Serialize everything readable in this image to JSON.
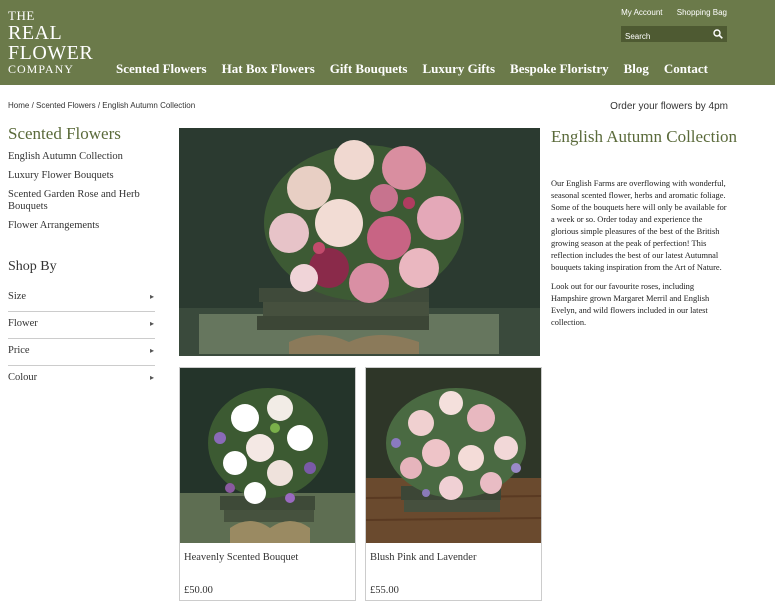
{
  "logo": {
    "line1": "THE",
    "line2": "REAL",
    "line3": "FLOWER",
    "line4": "COMPANY"
  },
  "toplinks": {
    "account": "My Account",
    "bag": "Shopping Bag"
  },
  "search": {
    "placeholder": "Search"
  },
  "nav": [
    "Scented Flowers",
    "Hat Box Flowers",
    "Gift Bouquets",
    "Luxury Gifts",
    "Bespoke Floristry",
    "Blog",
    "Contact"
  ],
  "breadcrumb": "Home / Scented Flowers / English Autumn Collection",
  "order_note": "Order your flowers by 4pm",
  "sidebar": {
    "title": "Scented Flowers",
    "links": [
      "English Autumn Collection",
      "Luxury Flower Bouquets",
      "Scented Garden Rose and Herb Bouquets",
      "Flower Arrangements"
    ],
    "shop_by": "Shop By",
    "filters": [
      "Size",
      "Flower",
      "Price",
      "Colour"
    ]
  },
  "collection": {
    "title": "English Autumn Collection",
    "para1": "Our English Farms are overflowing with wonderful, seasonal scented flower, herbs and aromatic foliage. Some of the bouquets here will only be available for a week or so. Order today and experience the glorious simple pleasures of the best of the British growing season at the peak of perfection! This reflection includes the best of our latest Autumnal bouquets taking inspiration from the Art of Nature.",
    "para2": "Look out for our favourite roses, including Hampshire grown Margaret Merril and English Evelyn, and wild flowers included in our latest collection."
  },
  "products": [
    {
      "name": "Heavenly Scented Bouquet",
      "price": "£50.00"
    },
    {
      "name": "Blush Pink and Lavender",
      "price": "£55.00"
    }
  ],
  "colors": {
    "header": "#6b7a4a",
    "accent": "#5a6a3a",
    "search_bg": "#4e5a32"
  }
}
